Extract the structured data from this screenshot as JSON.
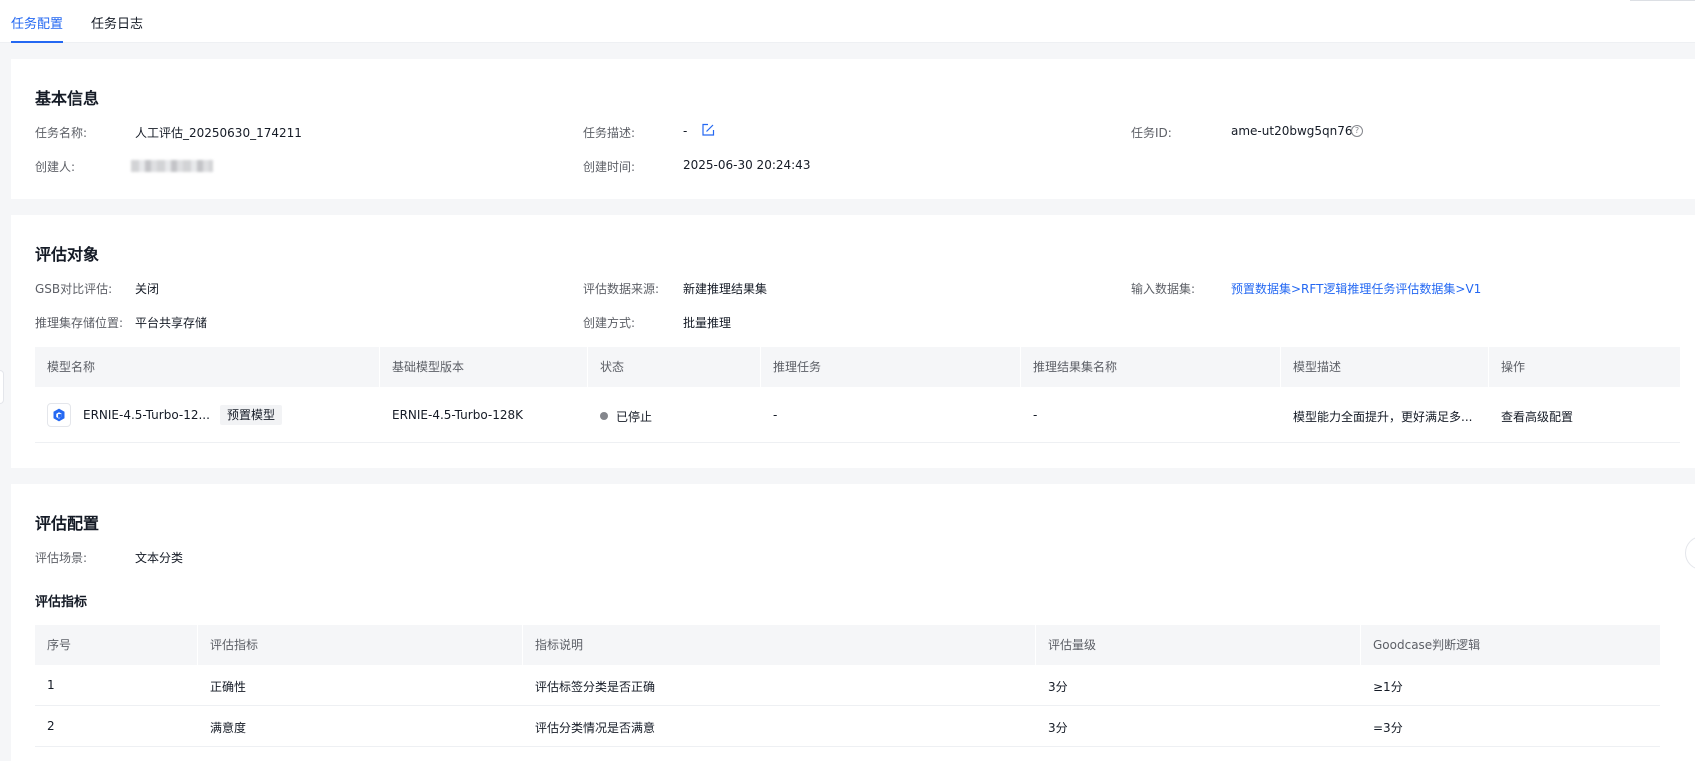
{
  "tabs": [
    {
      "label": "任务配置",
      "active": true
    },
    {
      "label": "任务日志",
      "active": false
    }
  ],
  "basic_info": {
    "title": "基本信息",
    "fields": {
      "task_name_label": "任务名称:",
      "task_name": "人工评估_20250630_174211",
      "task_desc_label": "任务描述:",
      "task_desc": "-",
      "task_id_label": "任务ID:",
      "task_id": "ame-ut20bwg5qn76",
      "creator_label": "创建人:",
      "created_time_label": "创建时间:",
      "created_time": "2025-06-30 20:24:43"
    }
  },
  "eval_object": {
    "title": "评估对象",
    "fields": {
      "gsb_label": "GSB对比评估:",
      "gsb": "关闭",
      "source_label": "评估数据来源:",
      "source": "新建推理结果集",
      "dataset_label": "输入数据集:",
      "dataset": "预置数据集>RFT逻辑推理任务评估数据集>V1",
      "storage_label": "推理集存储位置:",
      "storage": "平台共享存储",
      "create_mode_label": "创建方式:",
      "create_mode": "批量推理"
    },
    "table": {
      "headers": [
        "模型名称",
        "基础模型版本",
        "状态",
        "推理任务",
        "推理结果集名称",
        "模型描述",
        "操作"
      ],
      "rows": [
        {
          "model_name": "ERNIE-4.5-Turbo-12...",
          "tag": "预置模型",
          "base_version": "ERNIE-4.5-Turbo-128K",
          "status": "已停止",
          "status_color": "#84868c",
          "infer_task": "-",
          "result_set": "-",
          "description": "模型能力全面提升，更好满足多...",
          "action": "查看高级配置"
        }
      ]
    }
  },
  "eval_config": {
    "title": "评估配置",
    "scene_label": "评估场景:",
    "scene": "文本分类",
    "metrics_title": "评估指标",
    "table": {
      "headers": [
        "序号",
        "评估指标",
        "指标说明",
        "评估量级",
        "Goodcase判断逻辑"
      ],
      "rows": [
        {
          "index": "1",
          "metric": "正确性",
          "desc": "评估标签分类是否正确",
          "scale": "3分",
          "logic": "≥1分"
        },
        {
          "index": "2",
          "metric": "满意度",
          "desc": "评估分类情况是否满意",
          "scale": "3分",
          "logic": "=3分"
        }
      ]
    }
  },
  "colors": {
    "accent": "#2468f2",
    "page_bg": "#f5f6f8",
    "text": "#151b26",
    "label": "#5c5f66"
  }
}
